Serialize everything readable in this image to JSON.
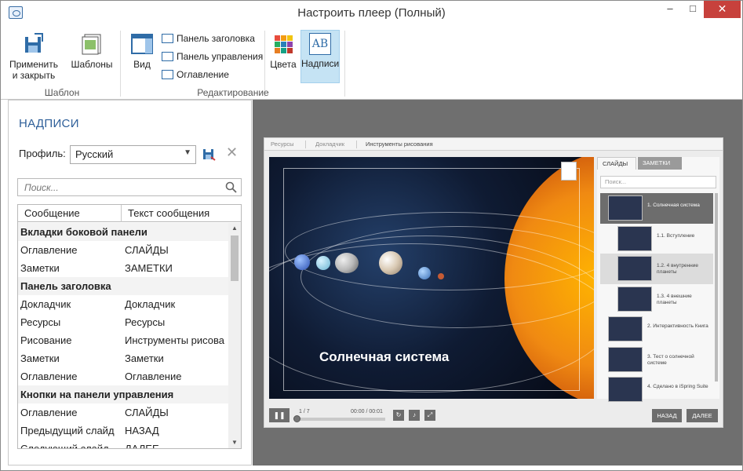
{
  "window": {
    "title": "Настроить плеер (Полный)",
    "minimize": "–",
    "maximize": "□",
    "close": "✕"
  },
  "ribbon": {
    "apply_label": "Применить\nи закрыть",
    "apply_line1": "Применить",
    "apply_line2": "и закрыть",
    "templates_label": "Шаблоны",
    "group_template": "Шаблон",
    "view_label": "Вид",
    "title_panel_label": "Панель заголовка",
    "control_panel_label": "Панель управления",
    "toc_label": "Оглавление",
    "colors_label": "Цвета",
    "captions_label": "Надписи",
    "captions_icon_text": "AB",
    "group_editing": "Редактирование"
  },
  "left": {
    "section_title": "НАДПИСИ",
    "profile_label": "Профиль:",
    "profile_value": "Русский",
    "search_placeholder": "Поиск...",
    "col_message": "Сообщение",
    "col_text": "Текст сообщения",
    "rows": [
      {
        "type": "group",
        "label": "Вкладки боковой панели"
      },
      {
        "type": "item",
        "message": "Оглавление",
        "text": "СЛАЙДЫ"
      },
      {
        "type": "item",
        "message": "Заметки",
        "text": "ЗАМЕТКИ"
      },
      {
        "type": "group",
        "label": "Панель заголовка"
      },
      {
        "type": "item",
        "message": "Докладчик",
        "text": "Докладчик"
      },
      {
        "type": "item",
        "message": "Ресурсы",
        "text": "Ресурсы"
      },
      {
        "type": "item",
        "message": "Рисование",
        "text": "Инструменты рисова"
      },
      {
        "type": "item",
        "message": "Заметки",
        "text": "Заметки"
      },
      {
        "type": "item",
        "message": "Оглавление",
        "text": "Оглавление"
      },
      {
        "type": "group",
        "label": "Кнопки на панели управления"
      },
      {
        "type": "item",
        "message": "Оглавление",
        "text": "СЛАЙДЫ"
      },
      {
        "type": "item",
        "message": "Предыдущий слайд",
        "text": "НАЗАД"
      },
      {
        "type": "item",
        "message": "Следующий слайд",
        "text": "ДАЛЕЕ"
      }
    ]
  },
  "player": {
    "top_links": [
      "Ресурсы",
      "Докладчик",
      "Инструменты рисования"
    ],
    "slide_title": "Солнечная система",
    "tab_slides": "СЛАЙДЫ",
    "tab_notes": "ЗАМЕТКИ",
    "search_placeholder": "Поиск...",
    "outline": [
      {
        "label": "1. Солнечная система",
        "level": 0,
        "state": "active"
      },
      {
        "label": "1.1. Вступление",
        "level": 1,
        "state": ""
      },
      {
        "label": "1.2. 4 внутренние планеты",
        "level": 1,
        "state": "hl"
      },
      {
        "label": "1.3. 4 внешние планеты",
        "level": 1,
        "state": ""
      },
      {
        "label": "2. Интерактивность Книга",
        "level": 0,
        "state": ""
      },
      {
        "label": "3. Тест о солнечной системе",
        "level": 0,
        "state": ""
      },
      {
        "label": "4. Сделано в iSpring Suite",
        "level": 0,
        "state": ""
      }
    ],
    "slide_counter": "1 / 7",
    "time": "00:00 / 00:01",
    "progress": 0.0,
    "prev_label": "НАЗАД",
    "next_label": "ДАЛЕЕ"
  }
}
